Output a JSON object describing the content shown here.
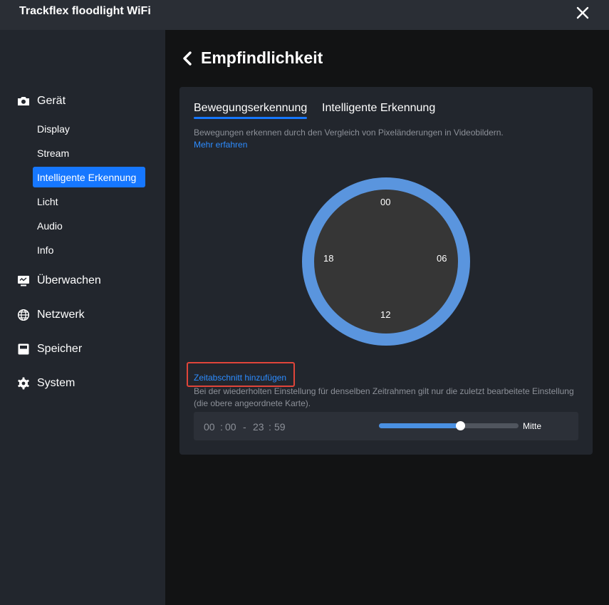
{
  "app": {
    "title": "Trackflex floodlight WiFi"
  },
  "sidebar": {
    "groups": [
      {
        "label": "Gerät",
        "icon": "camera-icon"
      },
      {
        "label": "Überwachen",
        "icon": "monitor-icon"
      },
      {
        "label": "Netzwerk",
        "icon": "globe-icon"
      },
      {
        "label": "Speicher",
        "icon": "storage-icon"
      },
      {
        "label": "System",
        "icon": "gear-icon"
      }
    ],
    "device_items": [
      {
        "label": "Display"
      },
      {
        "label": "Stream"
      },
      {
        "label": "Intelligente Erkennung",
        "active": true
      },
      {
        "label": "Licht"
      },
      {
        "label": "Audio"
      },
      {
        "label": "Info"
      }
    ]
  },
  "page": {
    "title": "Empfindlichkeit"
  },
  "tabs": [
    {
      "label": "Bewegungserkennung",
      "active": true
    },
    {
      "label": "Intelligente Erkennung",
      "active": false
    }
  ],
  "description": "Bewegungen erkennen durch den Vergleich von Pixeländerungen in Videobildern.",
  "learn_more": "Mehr erfahren",
  "clock": {
    "top": "00",
    "right": "06",
    "bottom": "12",
    "left": "18"
  },
  "add_period": "Zeitabschnitt hinzufügen",
  "note": "Bei der wiederholten Einstellung für denselben Zeitrahmen gilt nur die zuletzt bearbeitete Einstellung (die obere angeordnete Karte).",
  "time_range": {
    "start_hour": "00",
    "start_minute": "00",
    "separator": "-",
    "end_hour": "23",
    "end_minute": "59"
  },
  "sensitivity": {
    "value_fraction": 0.58,
    "label": "Mitte"
  },
  "colors": {
    "accent": "#1677ff",
    "ring": "#5a95de",
    "highlight_box": "#e0453a"
  }
}
